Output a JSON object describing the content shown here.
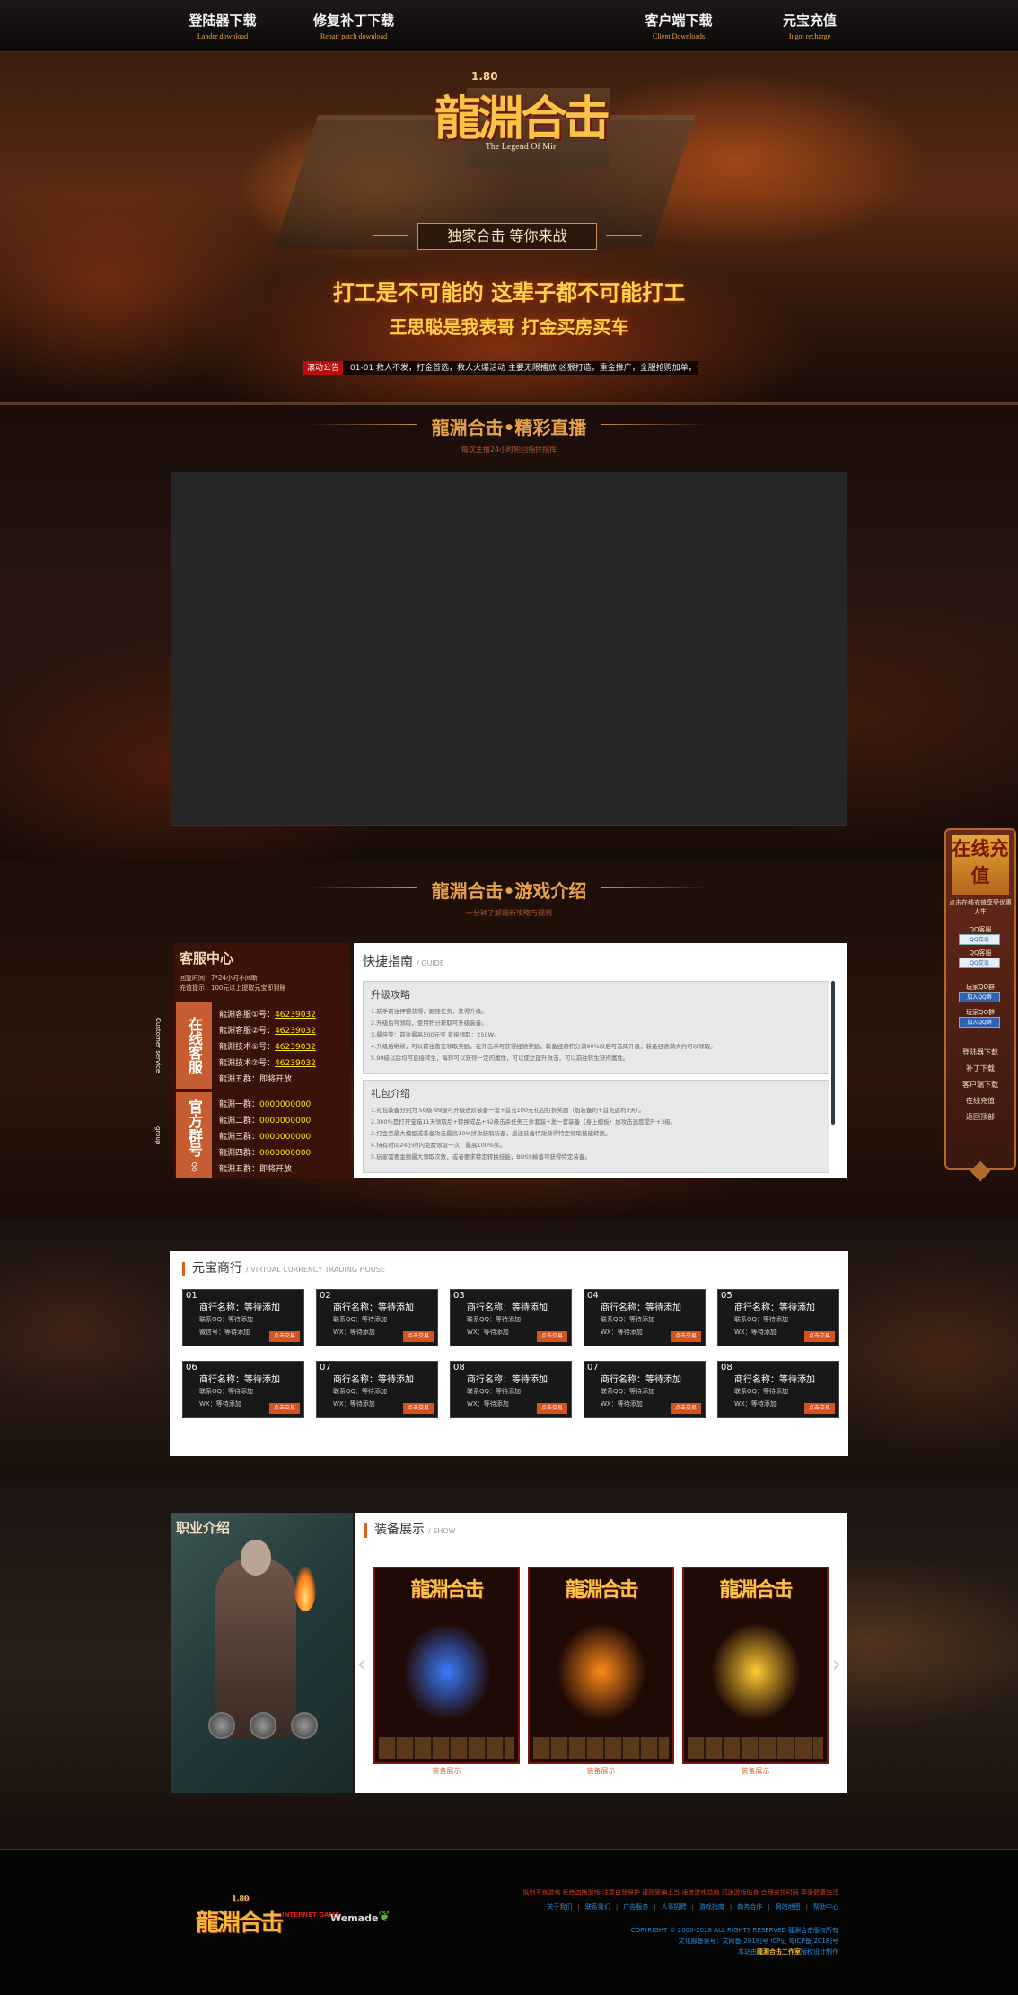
{
  "nav": {
    "items": [
      {
        "cn": "登陆器下载",
        "en": "Lander download"
      },
      {
        "cn": "修复补丁下载",
        "en": "Repair patch download"
      },
      {
        "cn": "客户端下载",
        "en": "Client Downloads"
      },
      {
        "cn": "元宝充值",
        "en": "Ingot recharge"
      }
    ]
  },
  "hero": {
    "logo_level": "1.80",
    "logo_title": "龍淵合击",
    "logo_sub": "The Legend Of Mir",
    "badge": "独家合击 等你来战",
    "slogan1": "打工是不可能的 这辈子都不可能打工",
    "slogan2": "王思聪是我表哥 打金买房买车",
    "ticker_tag": "滚动公告",
    "ticker_text": "01-01 救人不发，打金首选，救人火爆活动 主要无限播放 凶狠打造，重金推广，全服抢购加单，公司运营"
  },
  "live": {
    "title": "龍淵合击•精彩直播",
    "sub": "每次主播24小时轮回指挥指挥"
  },
  "intro": {
    "title": "龍淵合击•游戏介绍",
    "sub": "一分钟了解最新攻略与规则"
  },
  "service": {
    "title": "客服中心",
    "time": "回复时间：7*24小时不间断",
    "note": "充值提示：100元以上提取元宝即到账",
    "online_label": "在线客服",
    "online_en": "Customer service",
    "group_label": "官方群号",
    "group_en": "QQ group",
    "kefu": [
      {
        "label": "龍淵客服①号：",
        "num": "46239032"
      },
      {
        "label": "龍淵客服②号：",
        "num": "46239032"
      },
      {
        "label": "龍淵技术①号：",
        "num": "46239032"
      },
      {
        "label": "龍淵技术②号：",
        "num": "46239032"
      },
      {
        "label": "龍淵五群：",
        "num": "即将开放"
      }
    ],
    "groups": [
      {
        "label": "龍淵一群：",
        "num": "0000000000"
      },
      {
        "label": "龍淵二群：",
        "num": "0000000000"
      },
      {
        "label": "龍淵三群：",
        "num": "0000000000"
      },
      {
        "label": "龍淵四群：",
        "num": "0000000000"
      },
      {
        "label": "龍淵五群：",
        "num": "即将开放"
      }
    ]
  },
  "guide": {
    "title": "快捷指南",
    "title_en": "/ GUIDE",
    "box1": {
      "title": "升级攻略",
      "lines": [
        "1.新手前往押镖获得，跟随任务，获得升级。",
        "2.升级后可领取，使用积分获取可升级装备。",
        "3.最佳等：前往最高500元宝 直接领取：250W。",
        "4.升级后继续，可以前往首充领取奖励，在外击杀可获得经验奖励，装备经验积分满90%以后可选择升级，装备经验满大约可以领取。",
        "5.99级以后均可直接转生，每转可以获得一定的属性，可以使之提升攻击，可以前往转生获得属性。"
      ]
    },
    "box2": {
      "title": "礼包介绍",
      "lines": [
        "1.礼包装备分别为 50级-99级可升级进阶装备一套+首充100元礼包打折奖励（加装备的+首充返利3天）。",
        "2.300%是打开宝箱11天领取后+转换成品+42级击杀任务三件套装+发一套装备（身上模板）加攻击速度提升+3级。",
        "3.打金至最大模型或装备攻击最高10%拼攻获取装备，返还装备特效获得特定领取技能转换。",
        "4.持有时间24小时内免费领取一次，最高100%奖。",
        "5.玩家需要金额最大领取次数，或者要求特定转换技能，BOSS掉落可获得特定装备。"
      ]
    }
  },
  "trade": {
    "title": "元宝商行",
    "title_en": "/ VIRTUAL CURRENCY TRADING HOUSE",
    "cards": [
      {
        "no": "01",
        "name": "商行名称：等待添加",
        "l2": "联系QQ：等待添加",
        "l3": "微信号：等待添加",
        "btn": "点击交易"
      },
      {
        "no": "02",
        "name": "商行名称：等待添加",
        "l2": "联系QQ：等待添加",
        "l3": "WX：等待添加",
        "btn": "点击交易"
      },
      {
        "no": "03",
        "name": "商行名称：等待添加",
        "l2": "联系QQ：等待添加",
        "l3": "WX：等待添加",
        "btn": "点击交易"
      },
      {
        "no": "04",
        "name": "商行名称：等待添加",
        "l2": "联系QQ：等待添加",
        "l3": "WX：等待添加",
        "btn": "点击交易"
      },
      {
        "no": "05",
        "name": "商行名称：等待添加",
        "l2": "联系QQ：等待添加",
        "l3": "WX：等待添加",
        "btn": "点击交易"
      },
      {
        "no": "06",
        "name": "商行名称：等待添加",
        "l2": "联系QQ：等待添加",
        "l3": "WX：等待添加",
        "btn": "点击交易"
      },
      {
        "no": "07",
        "name": "商行名称：等待添加",
        "l2": "联系QQ：等待添加",
        "l3": "WX：等待添加",
        "btn": "点击交易"
      },
      {
        "no": "08",
        "name": "商行名称：等待添加",
        "l2": "联系QQ：等待添加",
        "l3": "WX：等待添加",
        "btn": "点击交易"
      },
      {
        "no": "07",
        "name": "商行名称：等待添加",
        "l2": "联系QQ：等待添加",
        "l3": "WX：等待添加",
        "btn": "点击交易"
      },
      {
        "no": "08",
        "name": "商行名称：等待添加",
        "l2": "联系QQ：等待添加",
        "l3": "WX：等待添加",
        "btn": "点击交易"
      }
    ]
  },
  "job": {
    "title": "职业介绍"
  },
  "equip": {
    "title": "装备展示",
    "title_en": "/ SHOW",
    "item_title": "龍淵合击",
    "items": [
      {
        "caption": "装备展示",
        "glow": "#3a7bff"
      },
      {
        "caption": "装备展示",
        "glow": "#ff8a1a"
      },
      {
        "caption": "装备展示",
        "glow": "#ffcc33"
      }
    ]
  },
  "footer": {
    "logo": "龍淵合击",
    "logo_level": "1.80",
    "red_logo": "INTERNET GAME",
    "wemade": "Wemade",
    "warning": "抵制不良游戏 拒绝盗版游戏 注意自我保护 谨防受骗上当 适度游戏益脑 沉迷游戏伤身 合理安排时间 享受健康生活",
    "links": [
      "关于我们",
      "联系我们",
      "广告服务",
      "人事招聘",
      "游戏指南",
      "商务合作",
      "网站地图",
      "帮助中心"
    ],
    "copyright": "COPYRIGHT © 2000-2018 ALL RIGHTS RESERVED 龍淵合击版权所有",
    "icp": "文化部备案号：文网备[2018]号 ICP证 粤ICP备[2018]号",
    "credit_prefix": "本站由",
    "credit_name": "龍淵合击工作室",
    "credit_suffix": "版权设计制作"
  },
  "side": {
    "top": "在线充值",
    "tip": "点击在线充值享受优惠人生",
    "kefu_label": "QQ客服",
    "qq_btn": "QQ交谈",
    "group_label": "玩家QQ群",
    "group_btn": "加入QQ群",
    "links": [
      "登陆器下载",
      "补丁下载",
      "客户端下载",
      "在线充值",
      "返回顶部"
    ]
  }
}
